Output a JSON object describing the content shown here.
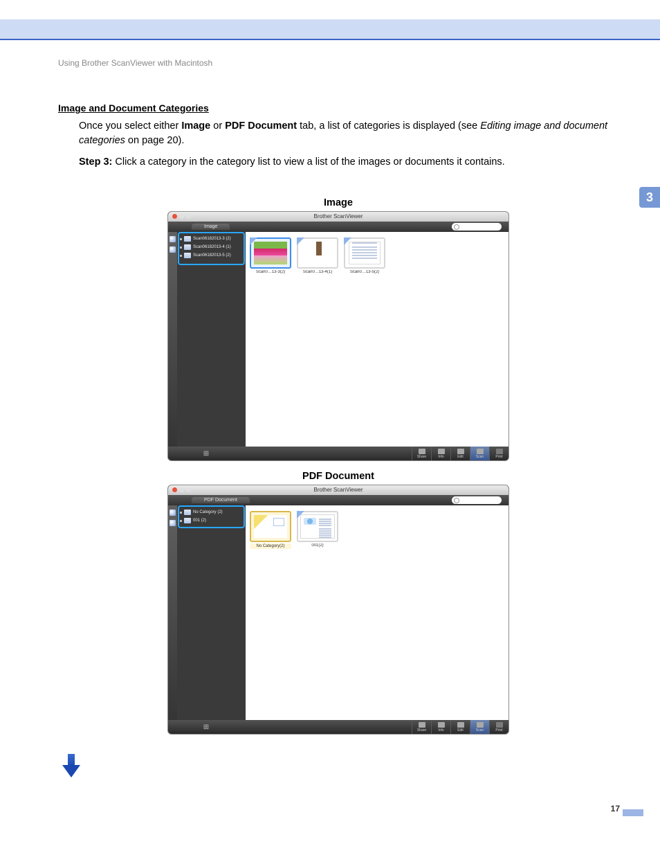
{
  "header": {
    "breadcrumb": "Using Brother ScanViewer with Macintosh"
  },
  "page": {
    "chapter_tab": "3",
    "number": "17"
  },
  "section": {
    "title": "Image and Document Categories",
    "para1_pre": "Once you select either ",
    "para1_b1": "Image",
    "para1_mid1": " or ",
    "para1_b2": "PDF Document",
    "para1_mid2": " tab, a list of categories is displayed (see ",
    "para1_i": "Editing image and document categories",
    "para1_post": " on page 20).",
    "para2_b": "Step 3:",
    "para2_text": " Click a category in the category list to view a list of the images or documents it contains."
  },
  "figure1": {
    "label": "Image",
    "app_title": "Brother ScanViewer",
    "tab": "Image",
    "sidebar": [
      "Scan06182013-3 (2)",
      "Scan06182013-4 (1)",
      "Scan06182013-5 (2)"
    ],
    "thumbs": [
      "Scan0…13-3(2)",
      "Scan0…13-4(1)",
      "Scan0…13-5(2)"
    ],
    "tools": {
      "share": "Share",
      "info": "Info",
      "edit": "Edit",
      "scan": "Scan",
      "print": "Print"
    }
  },
  "figure2": {
    "label": "PDF Document",
    "app_title": "Brother ScanViewer",
    "tab": "PDF Document",
    "sidebar": [
      "No Category (2)",
      "001 (2)"
    ],
    "thumbs": [
      "No Category(2)",
      "001(2)"
    ],
    "tools": {
      "share": "Share",
      "info": "Info",
      "edit": "Edit",
      "scan": "Scan",
      "print": "Print"
    }
  }
}
